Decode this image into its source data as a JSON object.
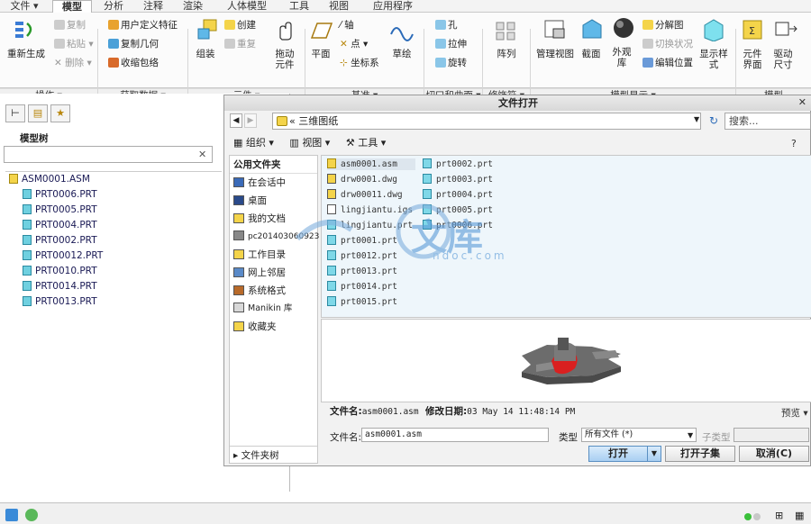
{
  "menubar": {
    "items": [
      "文件 ▾",
      "模型",
      "分析",
      "注释",
      "渲染",
      "人体模型",
      "工具",
      "视图",
      "应用程序"
    ],
    "active": "模型"
  },
  "ribbon": {
    "groups": [
      {
        "label": "操作 ▾"
      },
      {
        "label": "获取数据 ▾"
      },
      {
        "label": "元件 ▾"
      },
      {
        "label": "基准 ▾"
      },
      {
        "label": "切口和曲面 ▾"
      },
      {
        "label": "修饰符 ▾"
      },
      {
        "label": "模型显示 ▾"
      },
      {
        "label": "模型"
      }
    ],
    "op": {
      "regen": "重新生成",
      "copy": "复制",
      "paste": "粘贴 ▾",
      "delete": "✕ 删除 ▾"
    },
    "getdata": {
      "udf": "用户定义特征",
      "copygeom": "复制几何",
      "shrink": "收缩包络"
    },
    "comp": {
      "assemble": "组装",
      "create": "创建",
      "repeat": "重复",
      "drag": "拖动\n元件"
    },
    "datum": {
      "plane": "平面",
      "axis": "轴",
      "point": "点 ▾",
      "csys": "坐标系",
      "sketch": "草绘"
    },
    "cut": {
      "hole": "孔",
      "extrude": "拉伸",
      "revolve": "旋转"
    },
    "mod": {
      "pattern": "阵列"
    },
    "display": {
      "mgr": "管理视图",
      "section": "截面",
      "appearance": "外观\n库",
      "explode": "分解图",
      "editpos": "编辑位置",
      "toggle": "切换状况",
      "style": "显示样\n式"
    },
    "extra": {
      "ui": "元件\n界面",
      "drive": "驱动\n尺寸"
    }
  },
  "leftpanel": {
    "title": "模型树",
    "search_placeholder": "",
    "clear": "✕",
    "tree": [
      "ASM0001.ASM",
      "PRT0006.PRT",
      "PRT0005.PRT",
      "PRT0004.PRT",
      "PRT0002.PRT",
      "PRT00012.PRT",
      "PRT0010.PRT",
      "PRT0014.PRT",
      "PRT0013.PRT"
    ]
  },
  "dialog": {
    "title": "文件打开",
    "close": "✕",
    "path": "« 三维图纸",
    "search_placeholder": "搜索...",
    "toolbar": {
      "organize": "组织 ▾",
      "views": "视图 ▾",
      "tools": "工具 ▾"
    },
    "sidebar": {
      "header": "公用文件夹",
      "items": [
        "在会话中",
        "桌面",
        "我的文档",
        "pc201403060923",
        "工作目录",
        "网上邻居",
        "系统格式",
        "Manikin 库",
        "收藏夹"
      ],
      "footer": "▸ 文件夹树"
    },
    "files_col1": [
      "asm0001.asm",
      "drw0001.dwg",
      "drw00011.dwg",
      "lingjiantu.igs",
      "lingjiantu.prt",
      "prt0001.prt",
      "prt0012.prt",
      "prt0013.prt",
      "prt0014.prt",
      "prt0015.prt"
    ],
    "files_col2": [
      "prt0002.prt",
      "prt0003.prt",
      "prt0004.prt",
      "prt0005.prt",
      "prt0006.prt"
    ],
    "info": {
      "name_label": "文件名:",
      "name_value": "asm0001.asm",
      "date_label": "修改日期:",
      "date_value": "03 May 14 11:48:14 PM",
      "preview": "预览 ▾"
    },
    "filename_label": "文件名:",
    "filename_value": "asm0001.asm",
    "type_label": "类型",
    "type_value": "所有文件 (*)",
    "subtype_label": "子类型",
    "subtype_value": "",
    "buttons": {
      "open": "打开",
      "open_sub": "打开子集",
      "cancel": "取消(C)"
    }
  },
  "watermark": {
    "text": "文库",
    "sub": "ndoc.com"
  },
  "colors": {
    "accent": "#a9cff2",
    "tree_icon": "#6fd0e0",
    "preview_red": "#d92020"
  }
}
